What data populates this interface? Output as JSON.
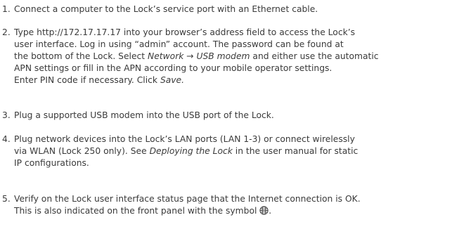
{
  "steps": [
    {
      "number": "1.",
      "text": "Connect a computer to the Lock’s service port with an Ethernet cable."
    },
    {
      "number": "2.",
      "line1": "Type http://172.17.17.17 into your browser’s address field to access the Lock’s",
      "line2": "user interface. Log in using “admin” account. The password can be found at",
      "line3_pre": "the bottom of the Lock. Select ",
      "line3_em": "Network → USB modem",
      "line3_post": " and either use the automatic",
      "line4": "APN settings or fill in the APN according to your mobile operator settings.",
      "line5_pre": "Enter PIN code if necessary. Click ",
      "line5_em": "Save."
    },
    {
      "number": "3.",
      "text": "Plug a supported USB modem into the USB port of the Lock."
    },
    {
      "number": "4.",
      "line1": "Plug network devices into the Lock’s LAN ports (LAN 1-3) or connect wirelessly",
      "line2_pre": "via WLAN (Lock 250 only). See ",
      "line2_em": "Deploying the Lock",
      "line2_post": " in the user manual for static",
      "line3": "IP configurations."
    },
    {
      "number": "5.",
      "line1": "Verify on the Lock user interface status page that the Internet connection is OK.",
      "line2_pre": "This is also indicated on the front panel with the symbol ",
      "line2_icon": "globe-icon",
      "line2_post": "."
    }
  ]
}
